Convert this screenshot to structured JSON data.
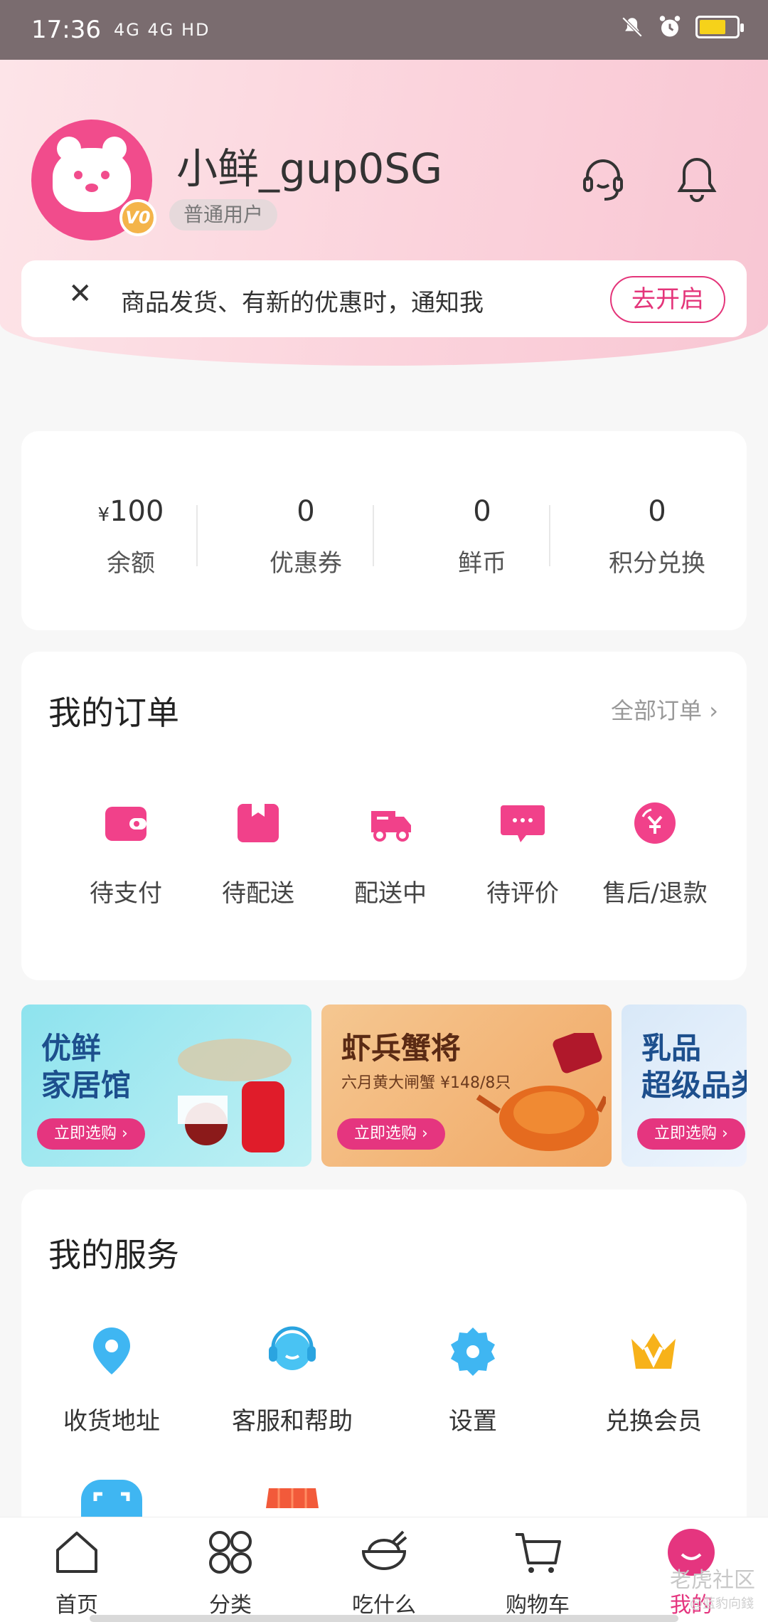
{
  "status": {
    "time": "17:36",
    "network": "4G 4G HD"
  },
  "profile": {
    "name": "小鲜_gup0SG",
    "tag": "普通用户",
    "badge": "V0"
  },
  "notify": {
    "text": "商品发货、有新的优惠时，通知我",
    "button": "去开启",
    "close": "✕"
  },
  "stats": [
    {
      "yen": "¥",
      "value": "100",
      "label": "余额"
    },
    {
      "value": "0",
      "label": "优惠券"
    },
    {
      "value": "0",
      "label": "鲜币"
    },
    {
      "value": "0",
      "label": "积分兑换"
    }
  ],
  "orders": {
    "title": "我的订单",
    "all": "全部订单",
    "items": [
      {
        "label": "待支付",
        "icon": "wallet-icon"
      },
      {
        "label": "待配送",
        "icon": "box-icon"
      },
      {
        "label": "配送中",
        "icon": "truck-icon"
      },
      {
        "label": "待评价",
        "icon": "comment-icon"
      },
      {
        "label": "售后/退款",
        "icon": "refund-icon"
      }
    ]
  },
  "banners": [
    {
      "title_line1": "优鲜",
      "title_line2": "家居馆",
      "button": "立即选购 ›"
    },
    {
      "title_line1": "虾兵蟹将",
      "subtitle": "六月黄大闸蟹 ¥148/8只",
      "button": "立即选购 ›"
    },
    {
      "title_line1": "乳品",
      "title_line2": "超级品类",
      "button": "立即选购 ›"
    }
  ],
  "services": {
    "title": "我的服务",
    "items": [
      {
        "label": "收货地址",
        "icon": "location-icon"
      },
      {
        "label": "客服和帮助",
        "icon": "support-icon"
      },
      {
        "label": "设置",
        "icon": "settings-icon"
      },
      {
        "label": "兑换会员",
        "icon": "crown-icon"
      }
    ]
  },
  "nav": [
    {
      "label": "首页",
      "icon": "home-icon"
    },
    {
      "label": "分类",
      "icon": "grid-icon"
    },
    {
      "label": "吃什么",
      "icon": "bowl-icon"
    },
    {
      "label": "购物车",
      "icon": "cart-icon"
    },
    {
      "label": "我的",
      "icon": "profile-icon"
    }
  ],
  "watermark": {
    "line1": "老虎社区",
    "line2": "@蓝豹向錢"
  },
  "colors": {
    "accent": "#e5357f",
    "header_bg": "#fbd3dc"
  }
}
